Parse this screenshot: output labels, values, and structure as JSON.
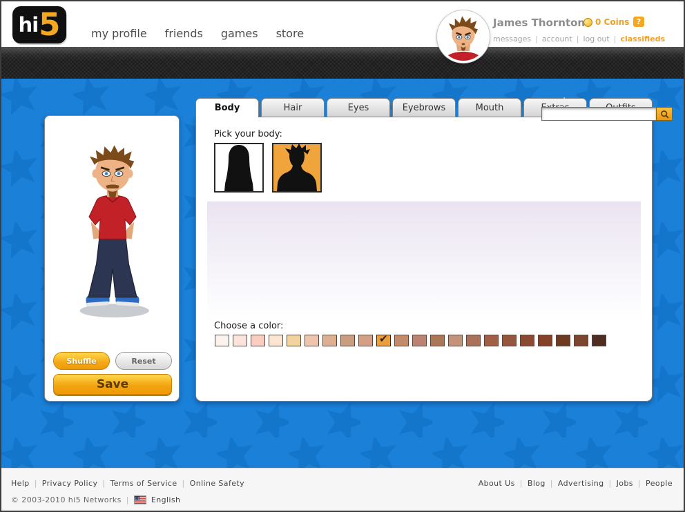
{
  "sep": "|",
  "theme": {
    "accent_orange": "#f5a81f",
    "page_blue": "#1a80d8",
    "selected_swatch_orange": "#ea9f3e"
  },
  "header": {
    "logo_hi": "hi",
    "logo_5": "5",
    "nav": [
      "my profile",
      "friends",
      "games",
      "store"
    ],
    "user_name": "James Thornton",
    "coins": "0 Coins",
    "help": "?",
    "user_links": [
      "messages",
      "account",
      "log out",
      "classifieds"
    ],
    "search_label": "search",
    "search_value": ""
  },
  "preview": {
    "shuffle": "Shuffle",
    "reset": "Reset",
    "save": "Save"
  },
  "editor": {
    "tabs": [
      "Body",
      "Hair",
      "Eyes",
      "Eyebrows",
      "Mouth",
      "Extras",
      "Outfits"
    ],
    "active_tab": "Body",
    "pick_label": "Pick your body:",
    "body_options": [
      "female",
      "male"
    ],
    "selected_body": "male",
    "selected_bg": "#f0a43c",
    "color_label": "Choose a color:",
    "checkmark": "✔",
    "selected_color_index": 9,
    "colors": [
      "#fcf3ef",
      "#fbe4dc",
      "#f9cdbf",
      "#f9e6d4",
      "#f2d3a0",
      "#eec4ad",
      "#dcb191",
      "#c99e80",
      "#d2a084",
      "#ea9f3e",
      "#c28c6b",
      "#bd8273",
      "#aa7758",
      "#c4937c",
      "#aa715d",
      "#a25f47",
      "#94573e",
      "#8d4a33",
      "#834229",
      "#6d3a23",
      "#7b4530",
      "#4e2d22"
    ]
  },
  "footer": {
    "links_left": [
      "Help",
      "Privacy Policy",
      "Terms of Service",
      "Online Safety"
    ],
    "links_right": [
      "About Us",
      "Blog",
      "Advertising",
      "Jobs",
      "People"
    ],
    "copyright": "© 2003-2010 hi5 Networks",
    "language": "English"
  }
}
